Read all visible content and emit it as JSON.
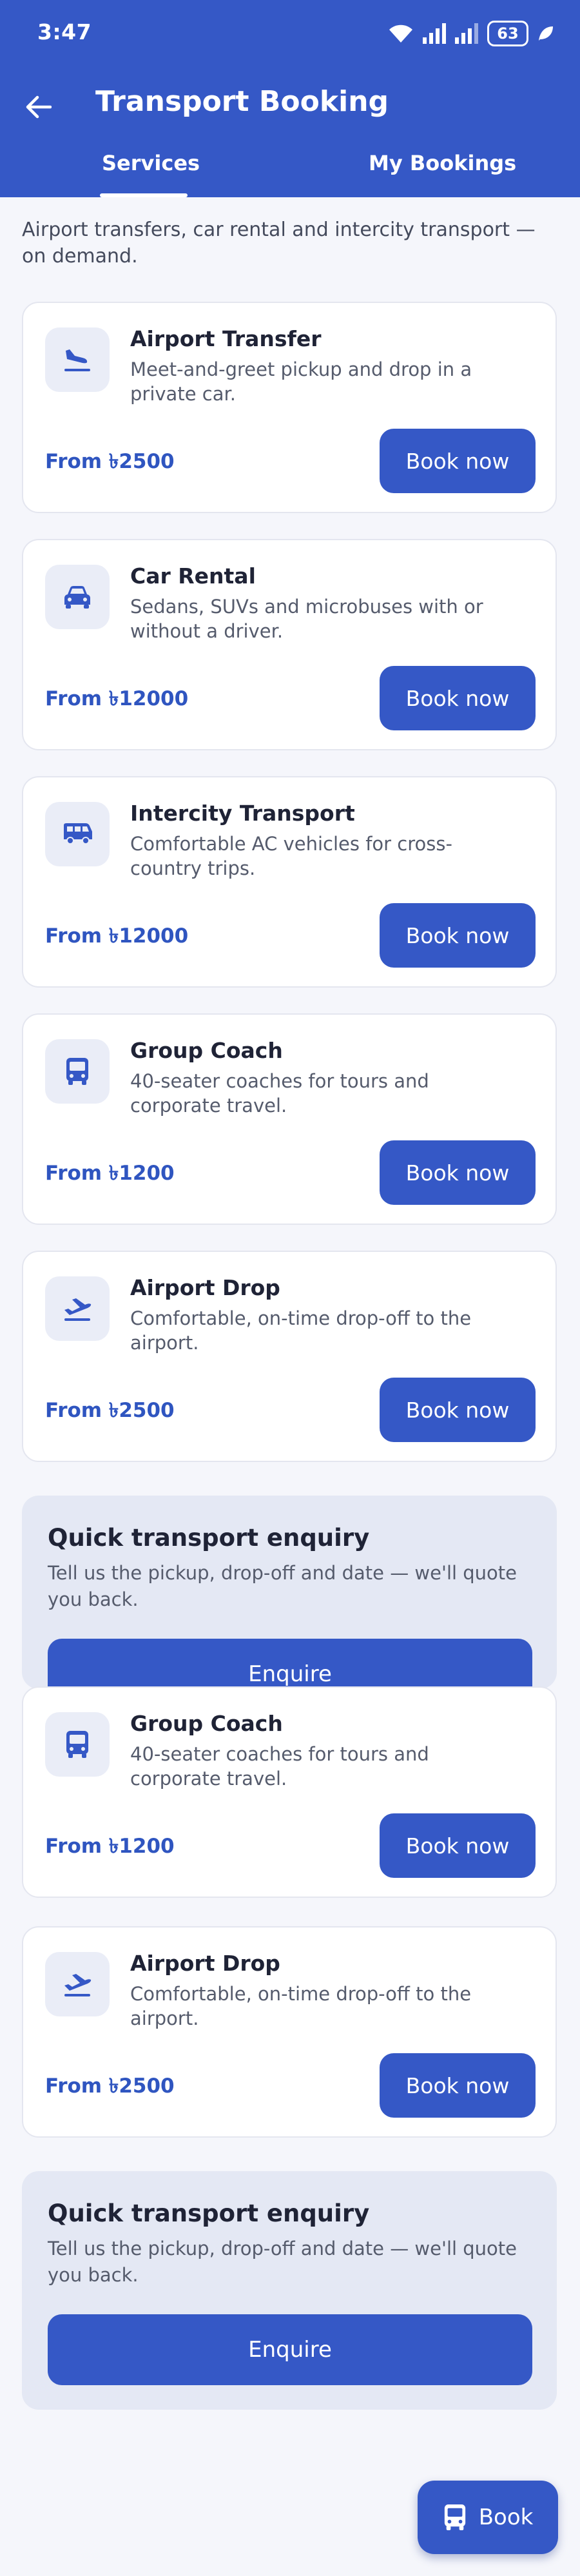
{
  "status_bar": {
    "time": "3:47",
    "battery": "63"
  },
  "app_bar": {
    "title": "Transport Booking"
  },
  "tabs": [
    {
      "label": "Services"
    },
    {
      "label": "My Bookings"
    }
  ],
  "intro": "Airport transfers, car rental and intercity transport — on demand.",
  "services": [
    {
      "title": "Airport Transfer",
      "desc": "Meet-and-greet pickup and drop in a private car.",
      "price": "From ৳2500",
      "button": "Book now",
      "icon": "plane-landing-icon"
    },
    {
      "title": "Car Rental",
      "desc": "Sedans, SUVs and microbuses with or without a driver.",
      "price": "From ৳12000",
      "button": "Book now",
      "icon": "car-icon"
    },
    {
      "title": "Intercity Transport",
      "desc": "Comfortable AC vehicles for cross-country trips.",
      "price": "From ৳12000",
      "button": "Book now",
      "icon": "van-icon"
    },
    {
      "title": "Group Coach",
      "desc": "40-seater coaches for tours and corporate travel.",
      "price": "From ৳1200",
      "button": "Book now",
      "icon": "bus-icon"
    },
    {
      "title": "Airport Drop",
      "desc": "Comfortable, on-time drop-off to the airport.",
      "price": "From ৳2500",
      "button": "Book now",
      "icon": "plane-takeoff-icon"
    },
    {
      "title": "Group Coach",
      "desc": "40-seater coaches for tours and corporate travel.",
      "price": "From ৳1200",
      "button": "Book now",
      "icon": "bus-icon"
    },
    {
      "title": "Airport Drop",
      "desc": "Comfortable, on-time drop-off to the airport.",
      "price": "From ৳2500",
      "button": "Book now",
      "icon": "plane-takeoff-icon"
    }
  ],
  "enquiry": {
    "title": "Quick transport enquiry",
    "desc": "Tell us the pickup, drop-off and date — we'll quote you back.",
    "button": "Enquire"
  },
  "fab": {
    "label": "Book",
    "icon": "bus-icon"
  },
  "colors": {
    "primary": "#3558c6",
    "background": "#f5f6fb",
    "enquiry_bg": "#e4e8f4",
    "price": "#2f55c0"
  }
}
